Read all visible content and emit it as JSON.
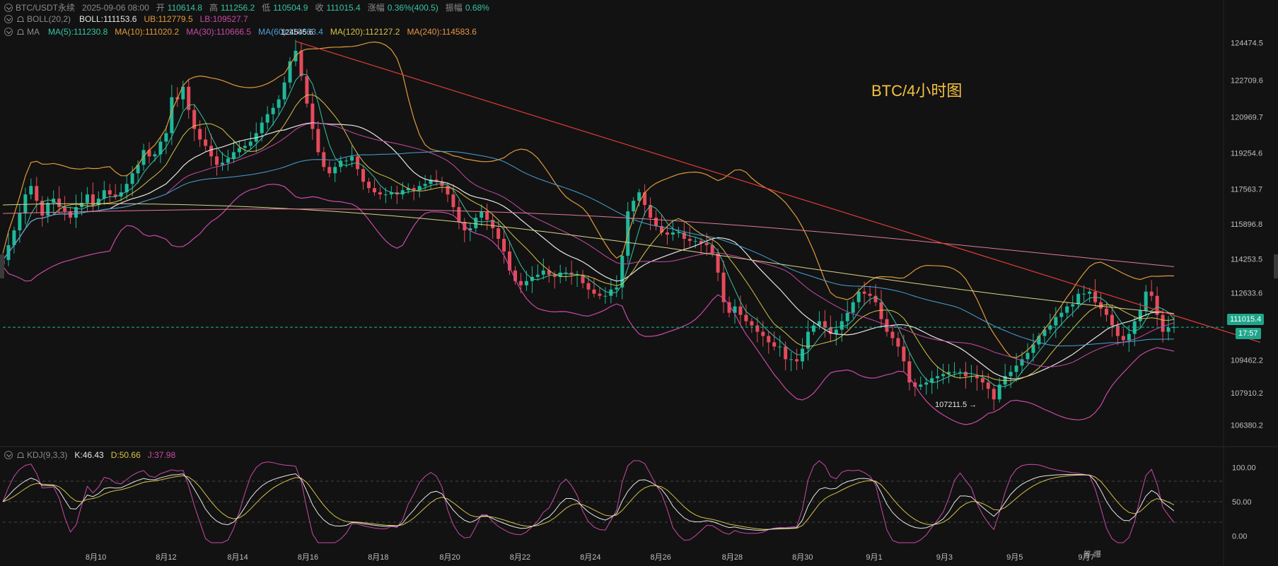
{
  "header": {
    "symbol": "BTC/USDT永续",
    "datetime": "2025-09-06 08:00",
    "open_label": "开",
    "open": "110614.8",
    "high_label": "高",
    "high": "111256.2",
    "low_label": "低",
    "low": "110504.9",
    "close_label": "收",
    "close": "111015.4",
    "change_label": "涨幅",
    "change": "0.36%(400.5)",
    "amp_label": "振幅",
    "amp": "0.68%"
  },
  "boll": {
    "name": "BOLL(20,2)",
    "mid": "BOLL:111153.6",
    "ub": "UB:112779.5",
    "lb": "LB:109527.7"
  },
  "ma": {
    "name": "MA",
    "ma5": "MA(5):111230.8",
    "ma10": "MA(10):111020.2",
    "ma30": "MA(30):110666.5",
    "ma60": "MA(60):110663.4",
    "ma120": "MA(120):112127.2",
    "ma240": "MA(240):114583.6"
  },
  "kdj": {
    "name": "KDJ(9,3,3)",
    "k": "K:46.43",
    "d": "D:50.66",
    "j": "J:37.98"
  },
  "annotation": "BTC/4小时图",
  "price_tag": "111015.4",
  "countdown": "17:57",
  "high_marker": "124545.6",
  "low_marker": "107211.5 →",
  "footer_right": "筹 爆",
  "colors": {
    "up": "#1fb89a",
    "down": "#e44b5b",
    "boll_ub": "#e09a3a",
    "boll_mid": "#e6e6e6",
    "boll_lb": "#c84aa6",
    "ma5": "#36c4a3",
    "ma10": "#d6c24a",
    "ma30": "#c84aa6",
    "ma60": "#4aa0d6",
    "ma120": "#d8d28a",
    "ma240": "#e07a9a",
    "trendline": "#e03a3a",
    "k": "#e6e6e6",
    "d": "#d6c24a",
    "j": "#c84aa6"
  },
  "chart_data": {
    "type": "candlestick",
    "timeframe": "4h",
    "y_ticks": [
      "124474.5",
      "122709.6",
      "120969.7",
      "119254.6",
      "117563.7",
      "115896.8",
      "114253.5",
      "112633.6",
      "109462.2",
      "107910.2",
      "106380.2"
    ],
    "kdj_ticks": [
      "100.00",
      "50.00",
      "0.00"
    ],
    "x_ticks": [
      "8月10",
      "8月12",
      "8月14",
      "8月16",
      "8月18",
      "8月20",
      "8月22",
      "8月24",
      "8月26",
      "8月28",
      "8月30",
      "9月1",
      "9月3",
      "9月5",
      "9月7"
    ],
    "ylim": [
      105600,
      125500
    ],
    "kdj_ylim": [
      -10,
      110
    ],
    "closes": [
      114200,
      114900,
      115600,
      116400,
      117300,
      117700,
      117000,
      116300,
      116900,
      117100,
      116700,
      116500,
      116200,
      116700,
      116900,
      117300,
      116800,
      117100,
      117500,
      117300,
      117200,
      117400,
      117800,
      118300,
      118700,
      119400,
      119100,
      119200,
      119800,
      120200,
      121900,
      121800,
      122400,
      121300,
      120400,
      119900,
      119600,
      119100,
      118700,
      118800,
      119000,
      119300,
      119500,
      119600,
      119800,
      120200,
      120700,
      121100,
      121400,
      121800,
      122600,
      123600,
      124100,
      122900,
      121600,
      120400,
      119300,
      118600,
      118300,
      118600,
      118900,
      118900,
      119100,
      118500,
      117900,
      117600,
      117400,
      117300,
      117300,
      117400,
      117300,
      117500,
      117600,
      117500,
      117700,
      117800,
      118000,
      117900,
      117700,
      117300,
      116700,
      116000,
      115600,
      115700,
      116200,
      116500,
      116100,
      115700,
      115200,
      114600,
      113700,
      113200,
      113000,
      113200,
      113400,
      113500,
      113700,
      113500,
      113400,
      113600,
      113600,
      113500,
      113500,
      113100,
      112800,
      112600,
      112500,
      112500,
      112800,
      112900,
      114400,
      116500,
      117000,
      117400,
      116800,
      116200,
      115800,
      115500,
      115400,
      115500,
      115500,
      115200,
      115100,
      115100,
      115000,
      114900,
      114500,
      113600,
      112200,
      111700,
      112000,
      111600,
      111300,
      111100,
      110800,
      110600,
      110300,
      110100,
      110100,
      109500,
      109500,
      109400,
      110000,
      110800,
      111100,
      111300,
      111000,
      110700,
      110900,
      111300,
      111700,
      112200,
      112700,
      112600,
      112500,
      112200,
      111400,
      110800,
      110500,
      110100,
      109400,
      108400,
      108200,
      108300,
      108400,
      108600,
      108700,
      108800,
      108900,
      108900,
      108900,
      108700,
      108700,
      108600,
      108400,
      108100,
      107600,
      108300,
      108700,
      108900,
      109200,
      109500,
      109800,
      110200,
      110600,
      110900,
      111100,
      111500,
      111700,
      112000,
      112100,
      112600,
      112600,
      112700,
      112200,
      111900,
      111600,
      111100,
      110600,
      110400,
      110700,
      111300,
      111800,
      112700,
      112500,
      111600,
      110800,
      111000,
      111015.4
    ],
    "current_price": 111015.4,
    "high": 124545.6,
    "low": 107211.5
  }
}
